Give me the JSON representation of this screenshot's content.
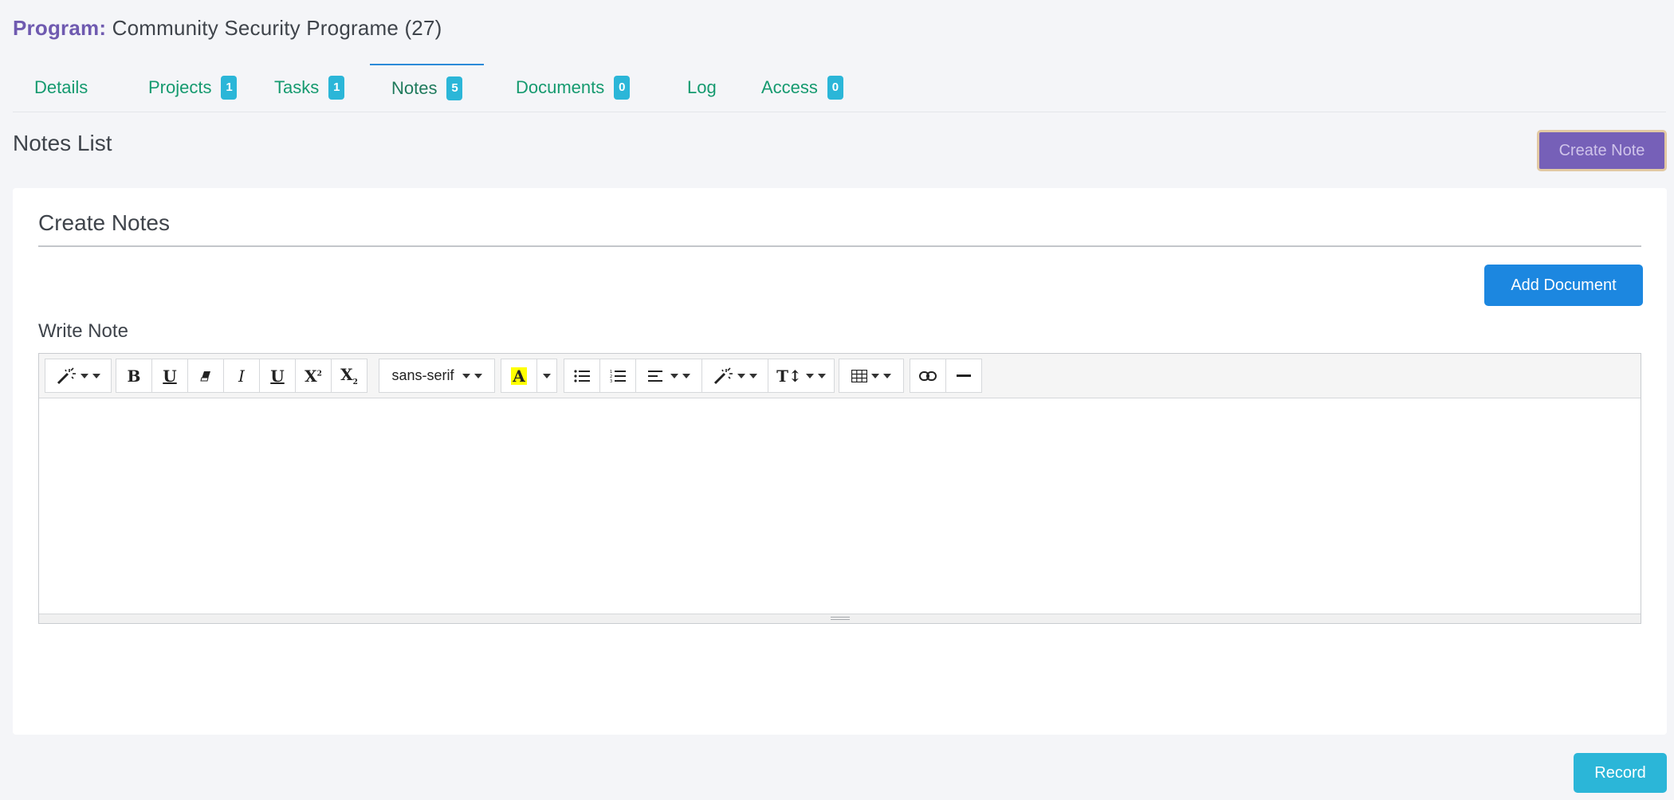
{
  "program": {
    "label": "Program:",
    "name": "Community Security Programe (27)"
  },
  "tabs": [
    {
      "label": "Details",
      "badge": null,
      "active": false
    },
    {
      "label": "Projects",
      "badge": "1",
      "active": false
    },
    {
      "label": "Tasks",
      "badge": "1",
      "active": false
    },
    {
      "label": "Notes",
      "badge": "5",
      "active": true
    },
    {
      "label": "Documents",
      "badge": "0",
      "active": false
    },
    {
      "label": "Log",
      "badge": null,
      "active": false
    },
    {
      "label": "Access",
      "badge": "0",
      "active": false
    }
  ],
  "notes_list": {
    "title": "Notes List",
    "create_button": "Create Note"
  },
  "create_notes": {
    "title": "Create Notes",
    "add_document_button": "Add Document",
    "write_note_label": "Write Note"
  },
  "editor": {
    "font_family": "sans-serif",
    "toolbar_icons": [
      "style-magic-icon",
      "bold-icon",
      "underline-icon",
      "eraser-icon",
      "italic-icon",
      "underline-alt-icon",
      "superscript-icon",
      "subscript-icon",
      "font-family-select",
      "text-color-icon",
      "unordered-list-icon",
      "ordered-list-icon",
      "paragraph-align-icon",
      "magic-style-icon",
      "line-height-icon",
      "table-icon",
      "link-icon",
      "horizontal-rule-icon"
    ],
    "content": ""
  },
  "footer": {
    "record_button": "Record"
  },
  "colors": {
    "program_label": "#6f5ab0",
    "tab_text": "#159a6f",
    "badge": "#2bb6d8",
    "create_note_bg": "#7660b8",
    "add_document_bg": "#1c87e0",
    "record_bg": "#2bb6d8"
  }
}
